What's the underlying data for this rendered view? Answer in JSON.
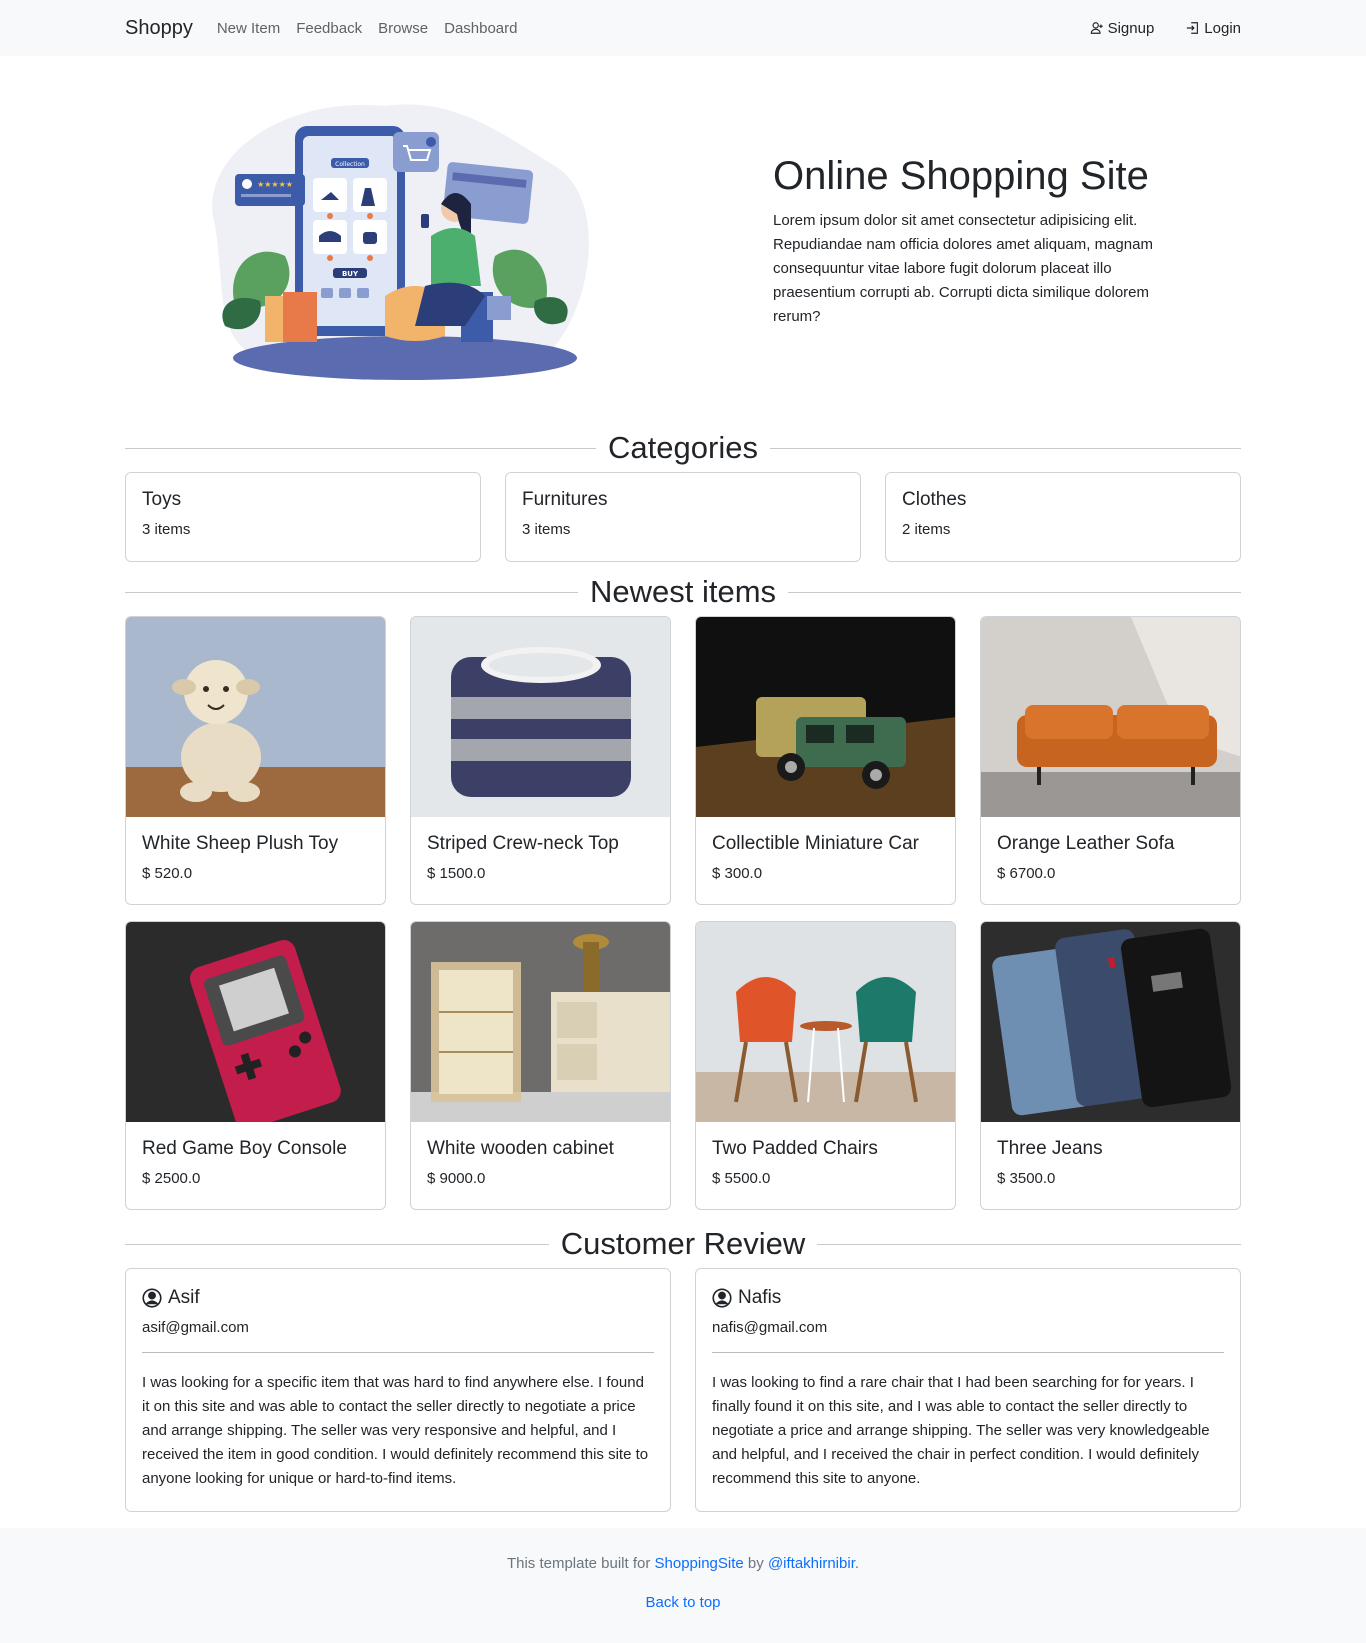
{
  "nav": {
    "brand": "Shoppy",
    "links": [
      "New Item",
      "Feedback",
      "Browse",
      "Dashboard"
    ],
    "signup": "Signup",
    "login": "Login"
  },
  "hero": {
    "title": "Online Shopping Site",
    "description": "Lorem ipsum dolor sit amet consectetur adipisicing elit. Repudiandae nam officia dolores amet aliquam, magnam consequuntur vitae labore fugit dolorum placeat illo praesentium corrupti ab. Corrupti dicta similique dolorem rerum?",
    "illustration": {
      "collection_label": "Collection",
      "buy_label": "BUY"
    }
  },
  "categories": {
    "heading": "Categories",
    "items": [
      {
        "name": "Toys",
        "count": "3 items"
      },
      {
        "name": "Furnitures",
        "count": "3 items"
      },
      {
        "name": "Clothes",
        "count": "2 items"
      }
    ]
  },
  "newest": {
    "heading": "Newest items",
    "items": [
      {
        "name": "White Sheep Plush Toy",
        "price": "$ 520.0"
      },
      {
        "name": "Striped Crew-neck Top",
        "price": "$ 1500.0"
      },
      {
        "name": "Collectible Miniature Car",
        "price": "$ 300.0"
      },
      {
        "name": "Orange Leather Sofa",
        "price": "$ 6700.0"
      },
      {
        "name": "Red Game Boy Console",
        "price": "$ 2500.0"
      },
      {
        "name": "White wooden cabinet",
        "price": "$ 9000.0"
      },
      {
        "name": "Two Padded Chairs",
        "price": "$ 5500.0"
      },
      {
        "name": "Three Jeans",
        "price": "$ 3500.0"
      }
    ]
  },
  "reviews": {
    "heading": "Customer Review",
    "items": [
      {
        "name": "Asif",
        "email": "asif@gmail.com",
        "text": "I was looking for a specific item that was hard to find anywhere else. I found it on this site and was able to contact the seller directly to negotiate a price and arrange shipping. The seller was very responsive and helpful, and I received the item in good condition. I would definitely recommend this site to anyone looking for unique or hard-to-find items."
      },
      {
        "name": "Nafis",
        "email": "nafis@gmail.com",
        "text": "I was looking to find a rare chair that I had been searching for for years. I finally found it on this site, and I was able to contact the seller directly to negotiate a price and arrange shipping. The seller was very knowledgeable and helpful, and I received the chair in perfect condition. I would definitely recommend this site to anyone."
      }
    ]
  },
  "footer": {
    "prefix": "This template built for ",
    "site_link": "ShoppingSite",
    "middle": " by ",
    "author_link": "@iftakhirnibir",
    "suffix": ".",
    "back_to_top": "Back to top"
  },
  "colors": {
    "navbar_bg": "#f8f9fa",
    "link_blue": "#0d6efd",
    "border": "#d0d3d6"
  }
}
